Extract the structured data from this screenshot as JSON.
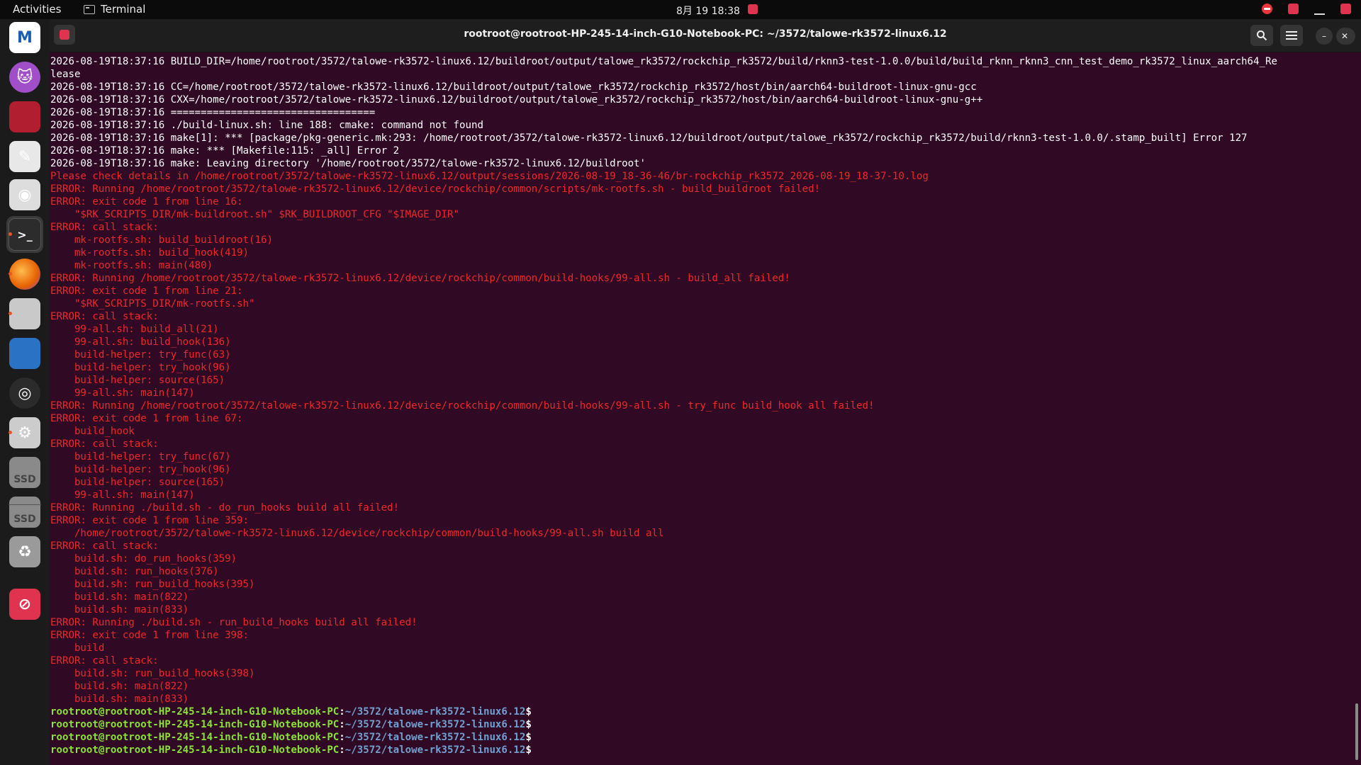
{
  "topbar": {
    "activities": "Activities",
    "app_name": "Terminal",
    "clock": "8月 19  18:38"
  },
  "dock": {
    "items": [
      {
        "name": "mail-app",
        "label": "M",
        "color": "#ffffff"
      },
      {
        "name": "chat-app",
        "label": "🐱",
        "color": "#a04fc8"
      },
      {
        "name": "screenshot-app",
        "label": "",
        "color": "#b01e2f"
      },
      {
        "name": "text-editor",
        "label": "✎",
        "color": "#e8e8e8"
      },
      {
        "name": "webcam-app",
        "label": "◉",
        "color": "#dddddd"
      },
      {
        "name": "terminal",
        "label": ">_",
        "color": "#2c2c2c"
      },
      {
        "name": "firefox",
        "label": "",
        "color": "#e66000"
      },
      {
        "name": "files",
        "label": "",
        "color": "#c9c9c9"
      },
      {
        "name": "writer",
        "label": "",
        "color": "#2a72c3"
      },
      {
        "name": "obs",
        "label": "◎",
        "color": "#2b2b2b"
      },
      {
        "name": "settings",
        "label": "⚙",
        "color": "#cccccc"
      },
      {
        "name": "ssd-1",
        "label": "SSD",
        "color": "#8a8a8a"
      },
      {
        "name": "ssd-2",
        "label": "SSD",
        "color": "#8a8a8a"
      },
      {
        "name": "trash",
        "label": "♻",
        "color": "#9a9a9a"
      },
      {
        "name": "blocked-app",
        "label": "⊘",
        "color": "#e0334f"
      }
    ]
  },
  "window": {
    "title": "rootroot@rootroot-HP-245-14-inch-G10-Notebook-PC: ~/3572/talowe-rk3572-linux6.12"
  },
  "terminal": {
    "lines": [
      {
        "t": "2026-08-19T18:37:16 BUILD_DIR=/home/rootroot/3572/talowe-rk3572-linux6.12/buildroot/output/talowe_rk3572/rockchip_rk3572/build/rknn3-test-1.0.0/build/build_rknn_rknn3_cnn_test_demo_rk3572_linux_aarch64_Re",
        "c": "n"
      },
      {
        "t": "lease",
        "c": "n"
      },
      {
        "t": "2026-08-19T18:37:16 CC=/home/rootroot/3572/talowe-rk3572-linux6.12/buildroot/output/talowe_rk3572/rockchip_rk3572/host/bin/aarch64-buildroot-linux-gnu-gcc",
        "c": "n"
      },
      {
        "t": "2026-08-19T18:37:16 CXX=/home/rootroot/3572/talowe-rk3572-linux6.12/buildroot/output/talowe_rk3572/rockchip_rk3572/host/bin/aarch64-buildroot-linux-gnu-g++",
        "c": "n"
      },
      {
        "t": "2026-08-19T18:37:16 ==================================",
        "c": "n"
      },
      {
        "t": "2026-08-19T18:37:16 ./build-linux.sh: line 188: cmake: command not found",
        "c": "n"
      },
      {
        "t": "2026-08-19T18:37:16 make[1]: *** [package/pkg-generic.mk:293: /home/rootroot/3572/talowe-rk3572-linux6.12/buildroot/output/talowe_rk3572/rockchip_rk3572/build/rknn3-test-1.0.0/.stamp_built] Error 127",
        "c": "n"
      },
      {
        "t": "2026-08-19T18:37:16 make: *** [Makefile:115: _all] Error 2",
        "c": "n"
      },
      {
        "t": "2026-08-19T18:37:16 make: Leaving directory '/home/rootroot/3572/talowe-rk3572-linux6.12/buildroot'",
        "c": "n"
      },
      {
        "t": "Please check details in /home/rootroot/3572/talowe-rk3572-linux6.12/output/sessions/2026-08-19_18-36-46/br-rockchip_rk3572_2026-08-19_18-37-10.log",
        "c": "e"
      },
      {
        "t": "ERROR: Running /home/rootroot/3572/talowe-rk3572-linux6.12/device/rockchip/common/scripts/mk-rootfs.sh - build_buildroot failed!",
        "c": "e"
      },
      {
        "t": "ERROR: exit code 1 from line 16:",
        "c": "e"
      },
      {
        "t": "    \"$RK_SCRIPTS_DIR/mk-buildroot.sh\" $RK_BUILDROOT_CFG \"$IMAGE_DIR\"",
        "c": "e"
      },
      {
        "t": "ERROR: call stack:",
        "c": "e"
      },
      {
        "t": "    mk-rootfs.sh: build_buildroot(16)",
        "c": "e"
      },
      {
        "t": "    mk-rootfs.sh: build_hook(419)",
        "c": "e"
      },
      {
        "t": "    mk-rootfs.sh: main(480)",
        "c": "e"
      },
      {
        "t": "ERROR: Running /home/rootroot/3572/talowe-rk3572-linux6.12/device/rockchip/common/build-hooks/99-all.sh - build_all failed!",
        "c": "e"
      },
      {
        "t": "ERROR: exit code 1 from line 21:",
        "c": "e"
      },
      {
        "t": "    \"$RK_SCRIPTS_DIR/mk-rootfs.sh\"",
        "c": "e"
      },
      {
        "t": "ERROR: call stack:",
        "c": "e"
      },
      {
        "t": "    99-all.sh: build_all(21)",
        "c": "e"
      },
      {
        "t": "    99-all.sh: build_hook(136)",
        "c": "e"
      },
      {
        "t": "    build-helper: try_func(63)",
        "c": "e"
      },
      {
        "t": "    build-helper: try_hook(96)",
        "c": "e"
      },
      {
        "t": "    build-helper: source(165)",
        "c": "e"
      },
      {
        "t": "    99-all.sh: main(147)",
        "c": "e"
      },
      {
        "t": "ERROR: Running /home/rootroot/3572/talowe-rk3572-linux6.12/device/rockchip/common/build-hooks/99-all.sh - try_func build_hook all failed!",
        "c": "e"
      },
      {
        "t": "ERROR: exit code 1 from line 67:",
        "c": "e"
      },
      {
        "t": "    build_hook",
        "c": "e"
      },
      {
        "t": "ERROR: call stack:",
        "c": "e"
      },
      {
        "t": "    build-helper: try_func(67)",
        "c": "e"
      },
      {
        "t": "    build-helper: try_hook(96)",
        "c": "e"
      },
      {
        "t": "    build-helper: source(165)",
        "c": "e"
      },
      {
        "t": "    99-all.sh: main(147)",
        "c": "e"
      },
      {
        "t": "ERROR: Running ./build.sh - do_run_hooks build all failed!",
        "c": "e"
      },
      {
        "t": "ERROR: exit code 1 from line 359:",
        "c": "e"
      },
      {
        "t": "    /home/rootroot/3572/talowe-rk3572-linux6.12/device/rockchip/common/build-hooks/99-all.sh build all",
        "c": "e"
      },
      {
        "t": "ERROR: call stack:",
        "c": "e"
      },
      {
        "t": "    build.sh: do_run_hooks(359)",
        "c": "e"
      },
      {
        "t": "    build.sh: run_hooks(376)",
        "c": "e"
      },
      {
        "t": "    build.sh: run_build_hooks(395)",
        "c": "e"
      },
      {
        "t": "    build.sh: main(822)",
        "c": "e"
      },
      {
        "t": "    build.sh: main(833)",
        "c": "e"
      },
      {
        "t": "ERROR: Running ./build.sh - run_build_hooks build all failed!",
        "c": "e"
      },
      {
        "t": "ERROR: exit code 1 from line 398:",
        "c": "e"
      },
      {
        "t": "    build",
        "c": "e"
      },
      {
        "t": "ERROR: call stack:",
        "c": "e"
      },
      {
        "t": "    build.sh: run_build_hooks(398)",
        "c": "e"
      },
      {
        "t": "    build.sh: main(822)",
        "c": "e"
      },
      {
        "t": "    build.sh: main(833)",
        "c": "e"
      }
    ],
    "prompt": {
      "user_host": "rootroot@rootroot-HP-245-14-inch-G10-Notebook-PC",
      "sep": ":",
      "path": "~/3572/talowe-rk3572-linux6.12",
      "symbol": "$",
      "count": 4
    },
    "colors": {
      "background": "#300a24",
      "text": "#ffffff",
      "error": "#ef2929",
      "prompt_user": "#8ae234",
      "prompt_path": "#729fcf"
    }
  }
}
